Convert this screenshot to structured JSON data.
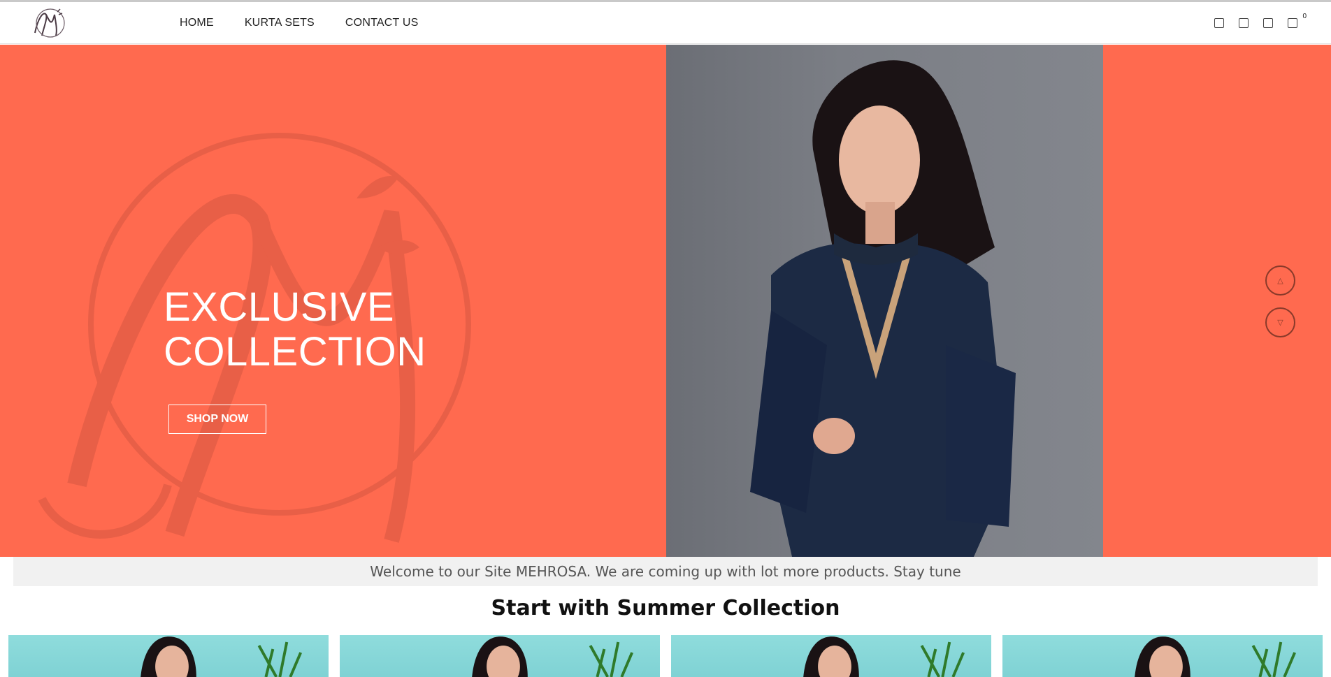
{
  "brand": {
    "logo_text": "Mehrosa",
    "logo_icon": "mehrosa-monogram-logo"
  },
  "nav": {
    "items": [
      {
        "label": "HOME"
      },
      {
        "label": "KURTA SETS"
      },
      {
        "label": "CONTACT US"
      }
    ]
  },
  "header_icons": {
    "search_icon": "search-icon",
    "user_icon": "user-icon",
    "wishlist_icon": "heart-icon",
    "cart_icon": "cart-icon",
    "cart_count": "0"
  },
  "hero": {
    "title_line1": "EXCLUSIVE",
    "title_line2": "COLLECTION",
    "cta_label": "SHOP NOW",
    "background_color": "#ff6a4f",
    "prev_icon": "chevron-up-icon",
    "next_icon": "chevron-down-icon"
  },
  "announcement": {
    "text": "Welcome to our Site MEHROSA. We are coming up with lot more products. Stay tune"
  },
  "collection": {
    "title": "Start with Summer Collection",
    "products": [
      {
        "image": "kurta-model-teal-background"
      },
      {
        "image": "kurta-model-teal-background"
      },
      {
        "image": "kurta-model-teal-background"
      },
      {
        "image": "kurta-model-teal-background"
      }
    ]
  }
}
